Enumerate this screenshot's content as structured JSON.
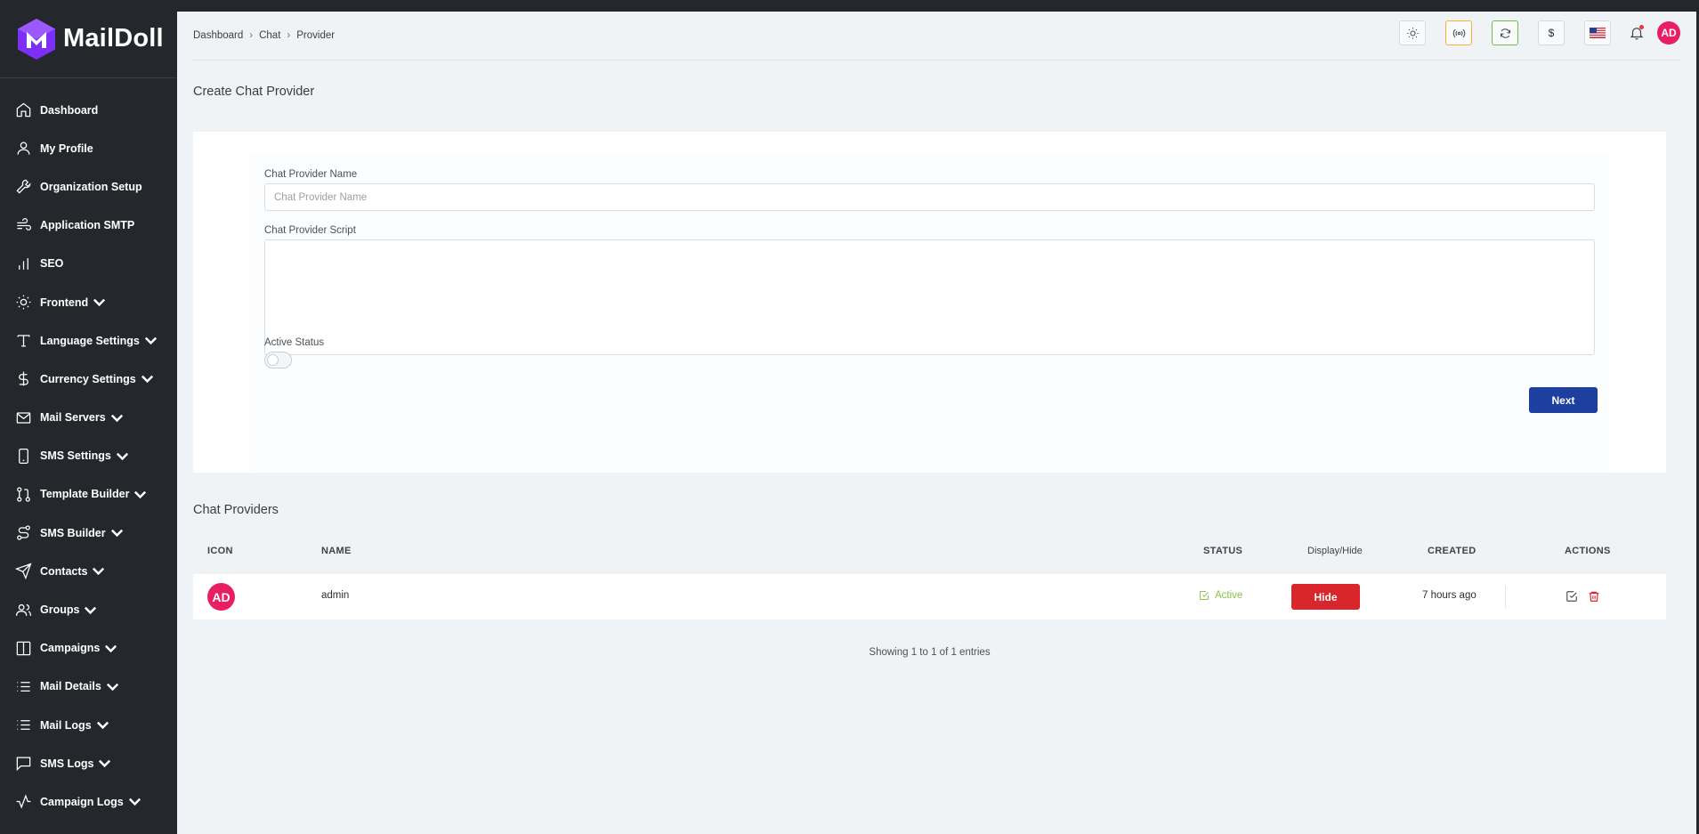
{
  "brand": {
    "name": "MailDoll",
    "logo_color": "#7b2ff7"
  },
  "sidebar": {
    "items": [
      {
        "label": "Dashboard",
        "icon": "home-icon",
        "chevron": false
      },
      {
        "label": "My Profile",
        "icon": "user-icon",
        "chevron": false
      },
      {
        "label": "Organization Setup",
        "icon": "wrench-icon",
        "chevron": false
      },
      {
        "label": "Application SMTP",
        "icon": "wind-icon",
        "chevron": false
      },
      {
        "label": "SEO",
        "icon": "bar-chart-icon",
        "chevron": false
      },
      {
        "label": "Frontend",
        "icon": "sun-icon",
        "chevron": true
      },
      {
        "label": "Language Settings",
        "icon": "type-icon",
        "chevron": true
      },
      {
        "label": "Currency Settings",
        "icon": "dollar-icon",
        "chevron": true
      },
      {
        "label": "Mail Servers",
        "icon": "mail-icon",
        "chevron": true
      },
      {
        "label": "SMS Settings",
        "icon": "smartphone-icon",
        "chevron": true
      },
      {
        "label": "Template Builder",
        "icon": "git-pull-request-icon",
        "chevron": true
      },
      {
        "label": "SMS Builder",
        "icon": "route-icon",
        "chevron": true
      },
      {
        "label": "Contacts",
        "icon": "send-icon",
        "chevron": true
      },
      {
        "label": "Groups",
        "icon": "users-icon",
        "chevron": true
      },
      {
        "label": "Campaigns",
        "icon": "columns-icon",
        "chevron": true
      },
      {
        "label": "Mail Details",
        "icon": "list-icon",
        "chevron": true
      },
      {
        "label": "Mail Logs",
        "icon": "list-icon",
        "chevron": true
      },
      {
        "label": "SMS Logs",
        "icon": "message-square-icon",
        "chevron": true
      },
      {
        "label": "Campaign Logs",
        "icon": "activity-icon",
        "chevron": true
      }
    ]
  },
  "header": {
    "breadcrumb": [
      "Dashboard",
      "Chat",
      "Provider"
    ],
    "currency_symbol": "$",
    "user_initials": "AD",
    "icons": [
      "sun-icon",
      "broadcast-icon",
      "refresh-icon",
      "dollar-icon",
      "us-flag-icon",
      "bell-icon"
    ]
  },
  "form": {
    "title": "Create Chat Provider",
    "name_label": "Chat Provider Name",
    "name_placeholder": "Chat Provider Name",
    "name_value": "",
    "script_label": "Chat Provider Script",
    "script_value": "",
    "status_label": "Active Status",
    "status_on": false,
    "submit_label": "Next"
  },
  "table": {
    "title": "Chat Providers",
    "columns": [
      "ICON",
      "NAME",
      "STATUS",
      "Display/Hide",
      "CREATED",
      "ACTIONS"
    ],
    "rows": [
      {
        "icon_initials": "AD",
        "name": "admin",
        "status": "Active",
        "toggle_label": "Hide",
        "created": "7 hours ago"
      }
    ],
    "footer": "Showing 1 to 1 of 1 entries"
  },
  "colors": {
    "primary": "#1d3fa0",
    "danger": "#d8262c",
    "success": "#8bc34a",
    "avatar": "#e91e63"
  }
}
